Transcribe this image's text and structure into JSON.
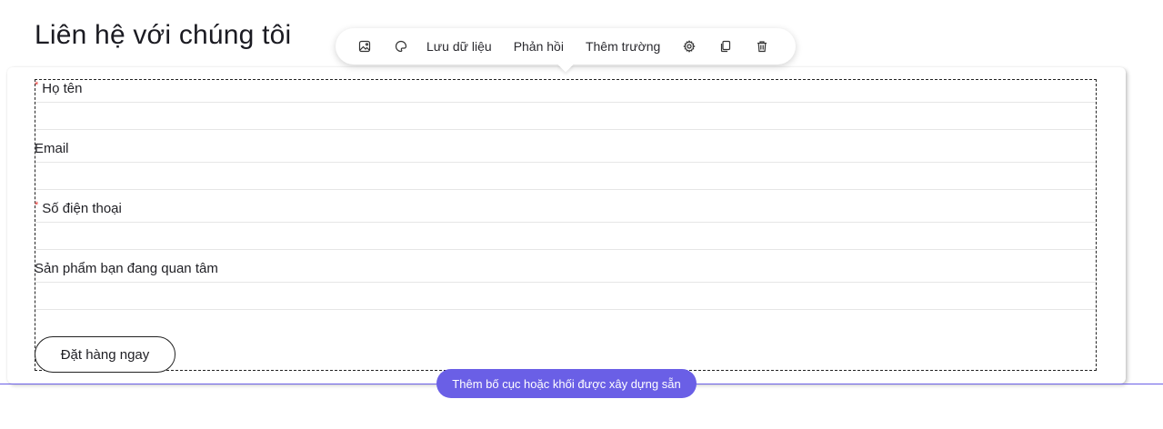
{
  "page": {
    "heading": "Liên hệ với chúng tôi"
  },
  "toolbar": {
    "items": [
      {
        "type": "icon",
        "icon": "image-icon"
      },
      {
        "type": "icon",
        "icon": "palette-icon"
      },
      {
        "type": "text",
        "label": "Lưu dữ liệu"
      },
      {
        "type": "text",
        "label": "Phản hồi"
      },
      {
        "type": "text",
        "label": "Thêm trường"
      },
      {
        "type": "icon",
        "icon": "gear-icon"
      },
      {
        "type": "icon",
        "icon": "copy-icon"
      },
      {
        "type": "icon",
        "icon": "trash-icon"
      }
    ]
  },
  "form": {
    "fields": [
      {
        "label": "Họ tên",
        "required": true,
        "required_mark": "*",
        "value": ""
      },
      {
        "label": "Email",
        "required": false,
        "value": ""
      },
      {
        "label": "Số điện thoại",
        "required": true,
        "required_mark": "*",
        "value": ""
      },
      {
        "label": "Sản phẩm bạn đang quan tâm",
        "required": false,
        "value": ""
      }
    ],
    "submit_label": "Đặt hàng ngay"
  },
  "insert": {
    "label": "Thêm bố cục hoặc khối được xây dựng sẵn"
  },
  "colors": {
    "accent": "#6a5fe6",
    "required": "#e53935"
  }
}
